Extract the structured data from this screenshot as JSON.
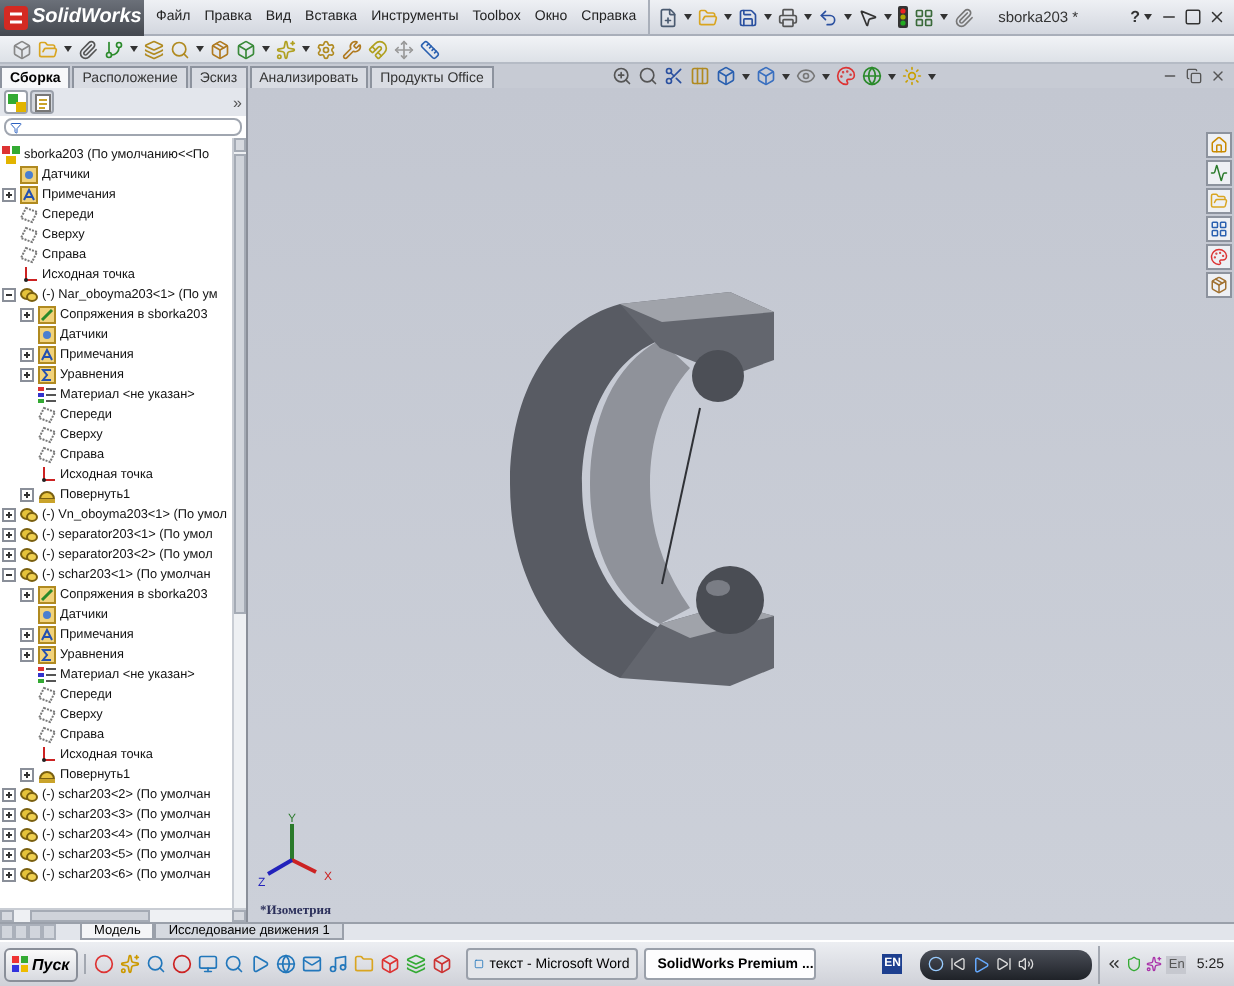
{
  "app": {
    "logo": "SolidWorks"
  },
  "menu": [
    "Файл",
    "Правка",
    "Вид",
    "Вставка",
    "Инструменты",
    "Toolbox",
    "Окно",
    "Справка"
  ],
  "title_bar": {
    "title": "sborka203 *",
    "help": "?"
  },
  "command_tabs": [
    {
      "label": "Сборка",
      "selected": true
    },
    {
      "label": "Расположение",
      "selected": false
    },
    {
      "label": "Эскиз",
      "selected": false
    },
    {
      "label": "Анализировать",
      "selected": false
    },
    {
      "label": "Продукты Office",
      "selected": false
    }
  ],
  "panel": {
    "expand": "»",
    "tabs": [
      {
        "kind": "feature-tree",
        "selected": true
      },
      {
        "kind": "property",
        "selected": false
      }
    ],
    "tree": [
      {
        "kind": "assembly",
        "label": "sborka203  (По умолчанию<<По",
        "children": [
          {
            "kind": "sensors",
            "label": "Датчики"
          },
          {
            "kind": "annotations",
            "label": "Примечания",
            "expanded": false
          },
          {
            "kind": "plane",
            "label": "Спереди"
          },
          {
            "kind": "plane",
            "label": "Сверху"
          },
          {
            "kind": "plane",
            "label": "Справа"
          },
          {
            "kind": "origin",
            "label": "Исходная точка"
          },
          {
            "kind": "part",
            "label": "(-) Nar_oboyma203<1> (По ум",
            "expanded": true,
            "children": [
              {
                "kind": "mates",
                "label": "Сопряжения в sborka203",
                "expanded": false
              },
              {
                "kind": "sensors",
                "label": "Датчики"
              },
              {
                "kind": "annotations",
                "label": "Примечания",
                "expanded": false
              },
              {
                "kind": "equations",
                "label": "Уравнения",
                "expanded": false
              },
              {
                "kind": "material",
                "label": "Материал <не указан>"
              },
              {
                "kind": "plane",
                "label": "Спереди"
              },
              {
                "kind": "plane",
                "label": "Сверху"
              },
              {
                "kind": "plane",
                "label": "Справа"
              },
              {
                "kind": "origin",
                "label": "Исходная точка"
              },
              {
                "kind": "feature",
                "label": "Повернуть1",
                "expanded": false
              }
            ]
          },
          {
            "kind": "part",
            "label": "(-) Vn_oboyma203<1> (По умол",
            "expanded": false
          },
          {
            "kind": "part",
            "label": "(-) separator203<1> (По умол",
            "expanded": false
          },
          {
            "kind": "part",
            "label": "(-) separator203<2> (По умол",
            "expanded": false
          },
          {
            "kind": "part",
            "label": "(-) schar203<1> (По умолчан",
            "expanded": true,
            "children": [
              {
                "kind": "mates",
                "label": "Сопряжения в sborka203",
                "expanded": false
              },
              {
                "kind": "sensors",
                "label": "Датчики"
              },
              {
                "kind": "annotations",
                "label": "Примечания",
                "expanded": false
              },
              {
                "kind": "equations",
                "label": "Уравнения",
                "expanded": false
              },
              {
                "kind": "material",
                "label": "Материал <не указан>"
              },
              {
                "kind": "plane",
                "label": "Спереди"
              },
              {
                "kind": "plane",
                "label": "Сверху"
              },
              {
                "kind": "plane",
                "label": "Справа"
              },
              {
                "kind": "origin",
                "label": "Исходная точка"
              },
              {
                "kind": "feature",
                "label": "Повернуть1",
                "expanded": false
              }
            ]
          },
          {
            "kind": "part",
            "label": "(-) schar203<2> (По умолчан",
            "expanded": false
          },
          {
            "kind": "part",
            "label": "(-) schar203<3> (По умолчан",
            "expanded": false
          },
          {
            "kind": "part",
            "label": "(-) schar203<4> (По умолчан",
            "expanded": false
          },
          {
            "kind": "part",
            "label": "(-) schar203<5> (По умолчан",
            "expanded": false
          },
          {
            "kind": "part",
            "label": "(-) schar203<6> (По умолчан",
            "expanded": false
          }
        ]
      }
    ]
  },
  "view": {
    "label": "*Изометрия",
    "axes": [
      "X",
      "Y",
      "Z"
    ]
  },
  "bottom_tabs": [
    {
      "label": "Модель",
      "selected": true
    },
    {
      "label": "Исследование движения 1",
      "selected": false
    }
  ],
  "taskbar": {
    "start": "Пуск",
    "tasks": [
      {
        "label": "текст - Microsoft Word",
        "selected": false
      },
      {
        "label": "SolidWorks Premium ...",
        "selected": true
      }
    ],
    "language": "EN",
    "tray_language": "En",
    "clock": "5:25"
  }
}
